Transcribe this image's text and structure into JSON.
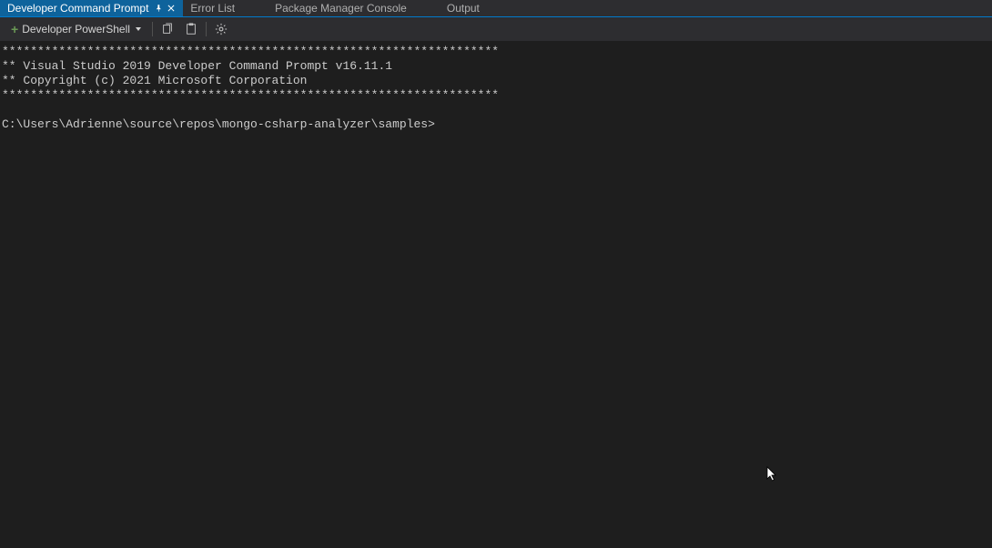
{
  "tabs": {
    "active": "Developer Command Prompt",
    "items": [
      {
        "label": "Developer Command Prompt"
      },
      {
        "label": "Error List"
      },
      {
        "label": "Package Manager Console"
      },
      {
        "label": "Output"
      }
    ]
  },
  "toolbar": {
    "new_terminal_label": "Developer PowerShell"
  },
  "terminal": {
    "lines": [
      "**********************************************************************",
      "** Visual Studio 2019 Developer Command Prompt v16.11.1",
      "** Copyright (c) 2021 Microsoft Corporation",
      "**********************************************************************",
      "",
      "C:\\Users\\Adrienne\\source\\repos\\mongo-csharp-analyzer\\samples>"
    ]
  }
}
